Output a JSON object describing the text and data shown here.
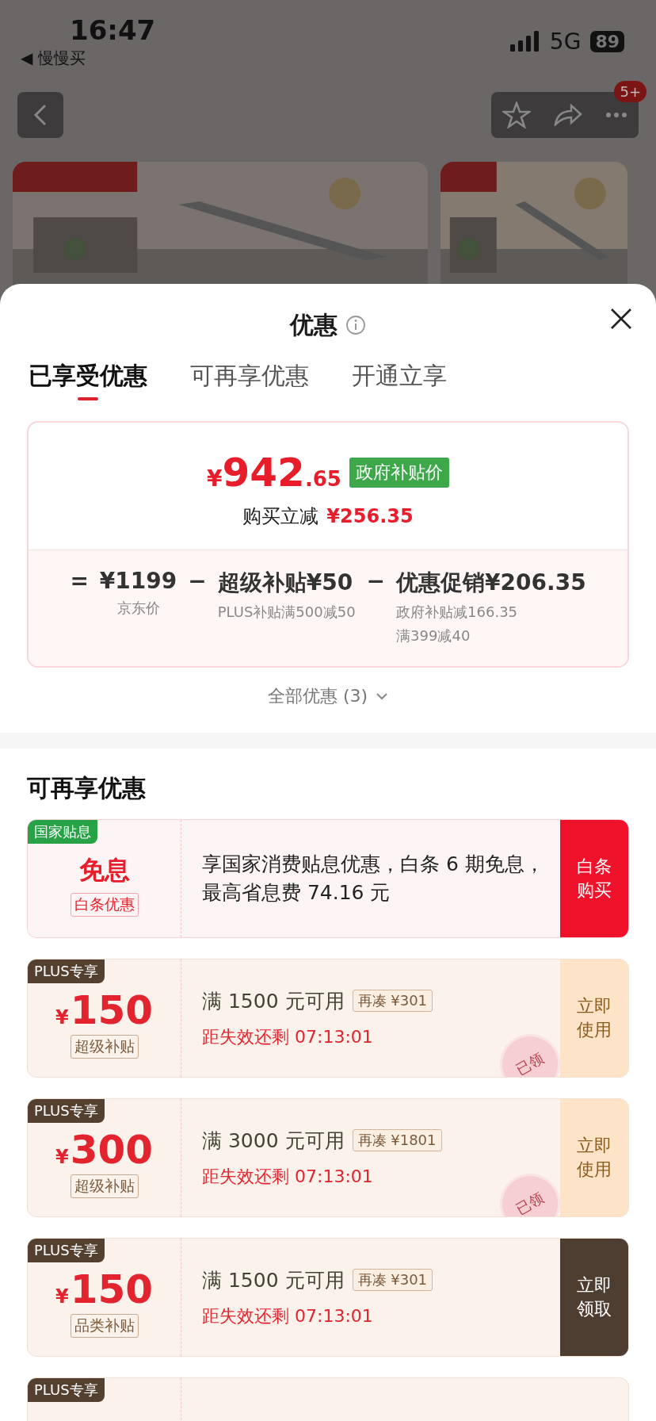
{
  "status_bar": {
    "time": "16:47",
    "back_app": "◀ 慢慢买",
    "network": "5G",
    "battery": "89"
  },
  "nav": {
    "badge": "5+"
  },
  "sheet": {
    "title": "优惠",
    "tabs": [
      {
        "label": "已享受优惠",
        "selected": true
      },
      {
        "label": "可再享优惠",
        "selected": false
      },
      {
        "label": "开通立享",
        "selected": false
      }
    ],
    "summary": {
      "price": {
        "currency": "¥",
        "integer": "942",
        "decimal": ".65"
      },
      "price_tag": "政府补贴价",
      "saving_label": "购买立减",
      "saving": "¥256.35",
      "breakdown": [
        {
          "kind": "op",
          "text": "="
        },
        {
          "kind": "item",
          "amount": "¥1199",
          "notes": [
            "京东价"
          ]
        },
        {
          "kind": "op",
          "text": "−"
        },
        {
          "kind": "item",
          "amount": "超级补贴¥50",
          "notes": [
            "PLUS补贴满500减50"
          ]
        },
        {
          "kind": "op",
          "text": "−"
        },
        {
          "kind": "item",
          "amount": "优惠促销¥206.35",
          "notes": [
            "政府补贴减166.35",
            "满399减40"
          ]
        }
      ]
    },
    "all_link": "全部优惠 (3)",
    "section_title": "可再享优惠",
    "coupons": [
      {
        "kind": "interest",
        "tag": "国家贴息",
        "headline": "免息",
        "label": "白条优惠",
        "description": "享国家消费贴息优惠，白条 6 期免息，最高省息费 74.16 元",
        "button": {
          "label": "白条购买",
          "kind": "buy"
        }
      },
      {
        "kind": "plus",
        "tag": "PLUS专享",
        "currency": "¥",
        "amount": "150",
        "label": "超级补贴",
        "condition": "满 1500 元可用",
        "extra": "再凑 ¥301",
        "countdown": "距失效还剩 07:13:01",
        "stamp": "已领",
        "button": {
          "label": "立即使用",
          "kind": "use"
        }
      },
      {
        "kind": "plus",
        "tag": "PLUS专享",
        "currency": "¥",
        "amount": "300",
        "label": "超级补贴",
        "condition": "满 3000 元可用",
        "extra": "再凑 ¥1801",
        "countdown": "距失效还剩 07:13:01",
        "stamp": "已领",
        "button": {
          "label": "立即使用",
          "kind": "use"
        }
      },
      {
        "kind": "plus",
        "tag": "PLUS专享",
        "currency": "¥",
        "amount": "150",
        "label": "品类补贴",
        "condition": "满 1500 元可用",
        "extra": "再凑 ¥301",
        "countdown": "距失效还剩 07:13:01",
        "button": {
          "label": "立即领取",
          "kind": "claim"
        }
      },
      {
        "kind": "partial",
        "tag": "PLUS专享"
      }
    ]
  }
}
